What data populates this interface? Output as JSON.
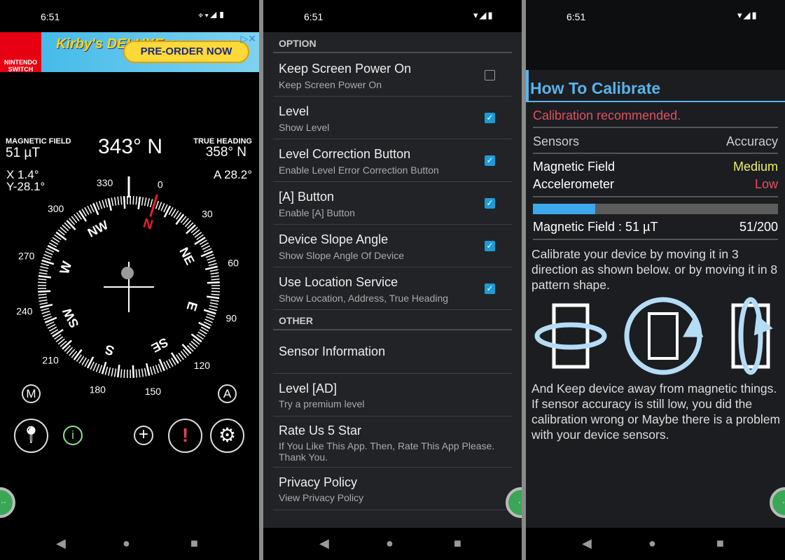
{
  "status": {
    "time": "6:51"
  },
  "compass_screen": {
    "ad": {
      "brand": "NINTENDO SWITCH",
      "title": "Kirby's DELUXE",
      "cta": "PRE-ORDER NOW"
    },
    "magnetic_field_label": "MAGNETIC FIELD",
    "magnetic_field_value": "51 µT",
    "heading": "343° N",
    "true_heading_label": "TRUE HEADING",
    "true_heading_value": "358° N",
    "x_tilt": "X  1.4°",
    "y_tilt": "Y-28.1°",
    "a_value": "A  28.2°",
    "heading_degrees": 343,
    "degree_labels": [
      "0",
      "30",
      "60",
      "90",
      "120",
      "150",
      "180",
      "210",
      "240",
      "270",
      "300",
      "330"
    ],
    "direction_labels": [
      "N",
      "NE",
      "E",
      "SE",
      "S",
      "SW",
      "W",
      "NW"
    ],
    "colors": {
      "needle": "#e8202a",
      "info": "#8fe08f",
      "alert": "#e8404a"
    },
    "buttons": {
      "m": "M",
      "a": "A"
    }
  },
  "settings_screen": {
    "option_header": "OPTION",
    "other_header": "OTHER",
    "options": [
      {
        "title": "Keep Screen Power On",
        "subtitle": "Keep Screen Power On",
        "checked": false
      },
      {
        "title": "Level",
        "subtitle": "Show Level",
        "checked": true
      },
      {
        "title": "Level Correction Button",
        "subtitle": "Enable Level Error Correction Button",
        "checked": true
      },
      {
        "title": "[A] Button",
        "subtitle": "Enable [A] Button",
        "checked": true
      },
      {
        "title": "Device Slope Angle",
        "subtitle": "Show Slope Angle Of Device",
        "checked": true
      },
      {
        "title": "Use Location Service",
        "subtitle": "Show Location, Address, True Heading",
        "checked": true
      }
    ],
    "other": [
      {
        "title": "Sensor Information",
        "subtitle": ""
      },
      {
        "title": "Level [AD]",
        "subtitle": "Try a premium level"
      },
      {
        "title": "Rate Us 5 Star",
        "subtitle": "If You Like This App. Then, Rate This App Please. Thank You."
      },
      {
        "title": "Privacy Policy",
        "subtitle": "View Privacy Policy"
      }
    ]
  },
  "calibrate_screen": {
    "title": "How To Calibrate",
    "warning": "Calibration recommended.",
    "col_sensors": "Sensors",
    "col_accuracy": "Accuracy",
    "sensors": [
      {
        "name": "Magnetic Field",
        "accuracy": "Medium",
        "color": "#f0f060"
      },
      {
        "name": "Accelerometer",
        "accuracy": "Low",
        "color": "#e85060"
      }
    ],
    "progress": {
      "label": "Magnetic Field : 51 µT",
      "value": 51,
      "max": 200,
      "text": "51/200"
    },
    "instructions": "Calibrate your device by moving it in 3 direction as shown below. or by moving it in 8 pattern shape.",
    "warning_text": "And Keep device away from magnetic things. If sensor accuracy is still low, you did the calibration wrong or Maybe there is a problem with your device sensors.",
    "accent": "#5ab4e8"
  }
}
